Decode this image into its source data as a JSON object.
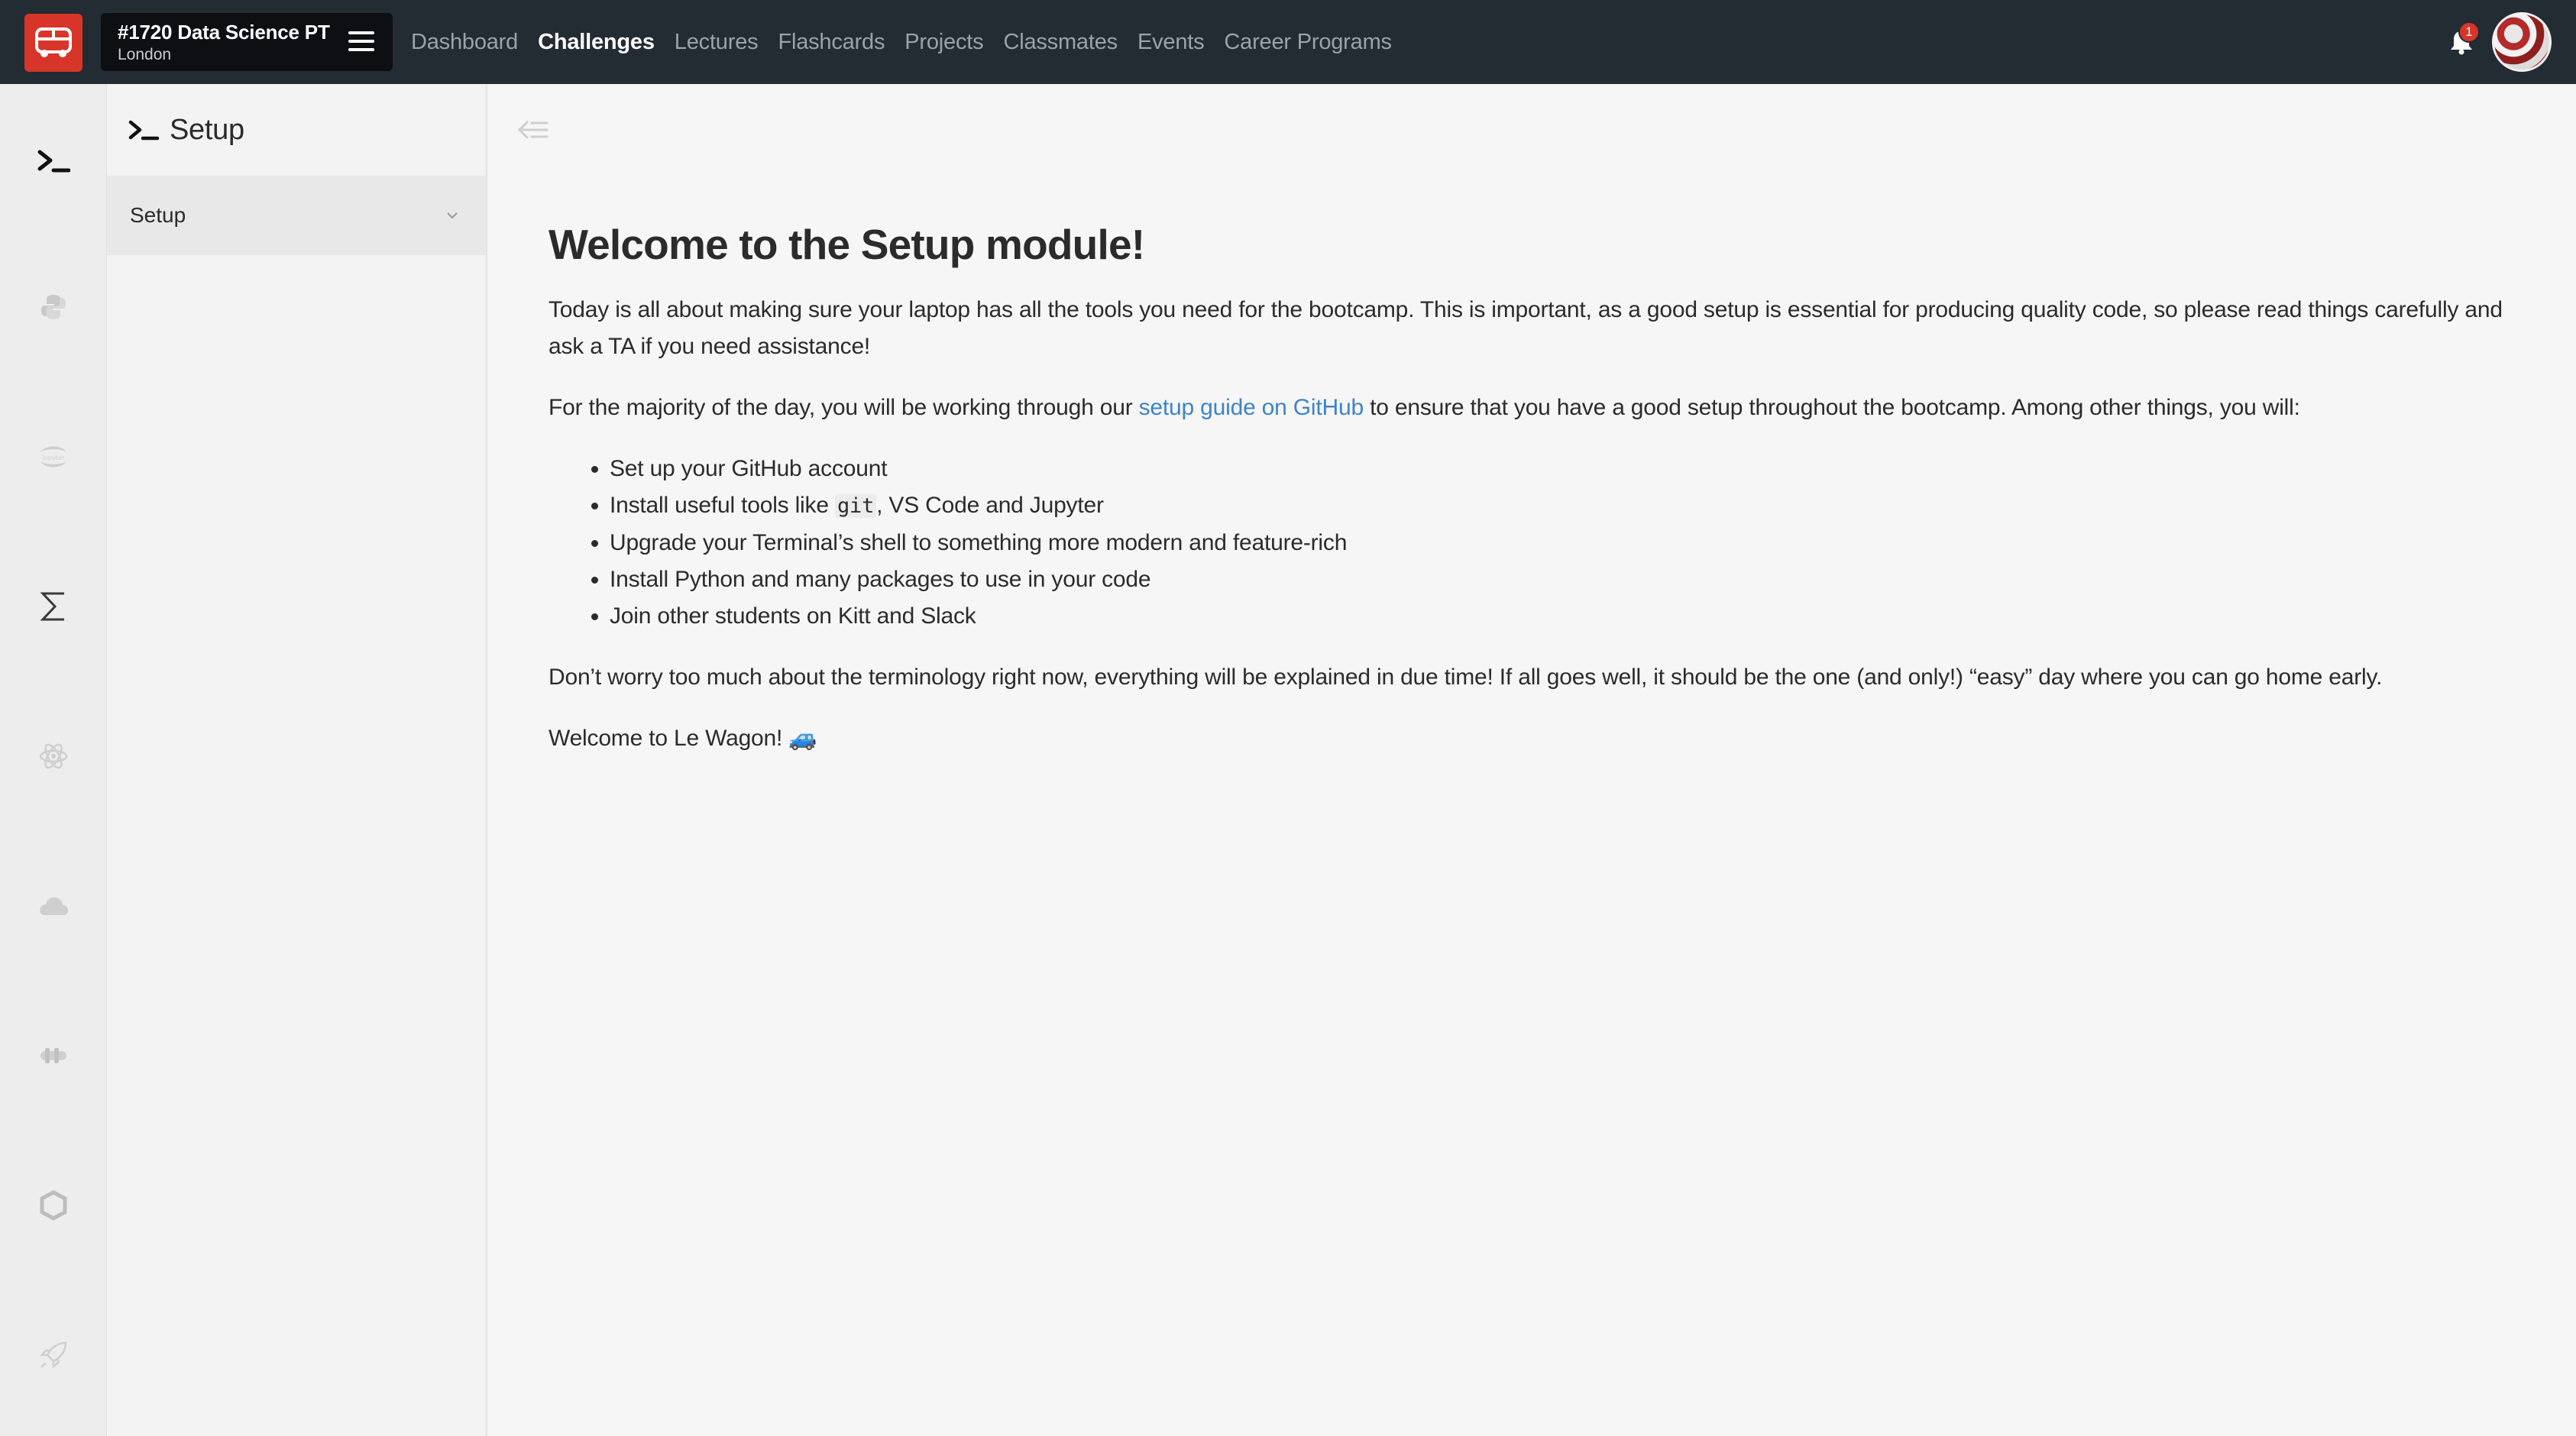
{
  "app": {
    "brand_icon": "bus-icon",
    "brand_color": "#d8352a",
    "topbar_color": "#232b33"
  },
  "batch": {
    "title": "#1720 Data Science PT",
    "subtitle": "London"
  },
  "nav": {
    "items": [
      {
        "label": "Dashboard",
        "active": false
      },
      {
        "label": "Challenges",
        "active": true
      },
      {
        "label": "Lectures",
        "active": false
      },
      {
        "label": "Flashcards",
        "active": false
      },
      {
        "label": "Projects",
        "active": false
      },
      {
        "label": "Classmates",
        "active": false
      },
      {
        "label": "Events",
        "active": false
      },
      {
        "label": "Career Programs",
        "active": false
      }
    ]
  },
  "notifications": {
    "count": "1"
  },
  "rail": {
    "icons": [
      "terminal-icon",
      "python-icon",
      "jupyter-icon",
      "sigma-icon",
      "atom-icon",
      "cloud-icon",
      "tensorflow-icon",
      "hexagon-icon",
      "rocket-icon"
    ]
  },
  "sidebar": {
    "title": "Setup",
    "items": [
      {
        "label": "Setup"
      }
    ]
  },
  "content": {
    "heading": "Welcome to the Setup module!",
    "intro": "Today is all about making sure your laptop has all the tools you need for the bootcamp. This is important, as a good setup is essential for producing quality code, so please read things carefully and ask a TA if you need assistance!",
    "para2_before": "For the majority of the day, you will be working through our ",
    "para2_link": "setup guide on GitHub",
    "para2_after": " to ensure that you have a good setup throughout the bootcamp. Among other things, you will:",
    "bullets": [
      "Set up your GitHub account",
      "Upgrade your Terminal’s shell to something more modern and feature-rich",
      "Install Python and many packages to use in your code",
      "Join other students on Kitt and Slack"
    ],
    "bullet2_before": "Install useful tools like ",
    "bullet2_code": "git",
    "bullet2_after": ", VS Code and Jupyter",
    "para3": "Don’t worry too much about the terminology right now, everything will be explained in due time! If all goes well, it should be the one (and only!) “easy” day where you can go home early.",
    "closing": "Welcome to Le Wagon! 🚙"
  }
}
